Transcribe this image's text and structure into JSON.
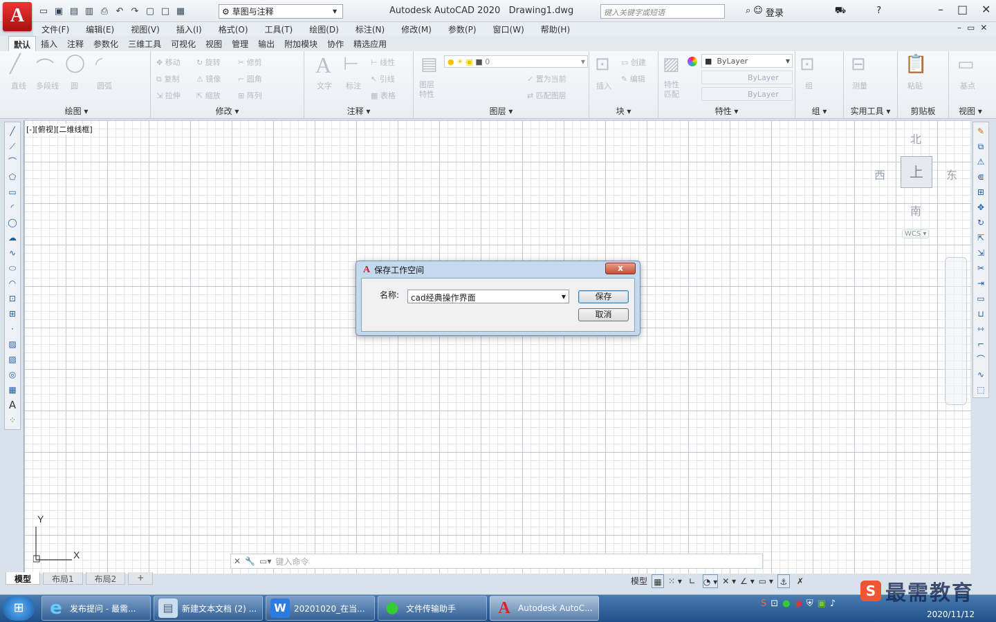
{
  "app": {
    "logo": "A",
    "title": "Autodesk AutoCAD 2020",
    "document": "Drawing1.dwg",
    "workspace": "草图与注释",
    "search_placeholder": "键入关键字或短语",
    "login": "登录",
    "accent": "#c8202a"
  },
  "menu": [
    "文件(F)",
    "编辑(E)",
    "视图(V)",
    "插入(I)",
    "格式(O)",
    "工具(T)",
    "绘图(D)",
    "标注(N)",
    "修改(M)",
    "参数(P)",
    "窗口(W)",
    "帮助(H)"
  ],
  "ribbon_tabs": [
    "默认",
    "插入",
    "注释",
    "参数化",
    "三维工具",
    "可视化",
    "视图",
    "管理",
    "输出",
    "附加模块",
    "协作",
    "精选应用"
  ],
  "ribbon": {
    "draw": {
      "title": "绘图",
      "items": [
        "直线",
        "多段线",
        "圆",
        "圆弧"
      ]
    },
    "modify": {
      "title": "修改",
      "items": [
        "移动",
        "旋转",
        "修剪",
        "复制",
        "镜像",
        "圆角",
        "拉伸",
        "缩放",
        "阵列"
      ]
    },
    "annotation": {
      "title": "注释",
      "items": [
        "文字",
        "标注",
        "线性",
        "引线",
        "表格"
      ]
    },
    "layers": {
      "title": "图层",
      "items": [
        "图层特性",
        "置为当前",
        "匹配图层"
      ],
      "current_layer": "0"
    },
    "block": {
      "title": "块",
      "items": [
        "插入",
        "创建",
        "编辑"
      ]
    },
    "properties": {
      "title": "特性",
      "items": [
        "特性匹配"
      ],
      "color": "ByLayer",
      "linetype": "ByLayer",
      "lineweight": "ByLayer"
    },
    "group": {
      "title": "组",
      "items": [
        "组"
      ]
    },
    "utilities": {
      "title": "实用工具",
      "items": [
        "测量"
      ]
    },
    "clipboard": {
      "title": "剪贴板",
      "items": [
        "粘贴"
      ]
    },
    "view": {
      "title": "视图",
      "items": [
        "基点"
      ]
    }
  },
  "viewport": {
    "label": "[-][俯视][二维线框]"
  },
  "viewcube": {
    "north": "北",
    "south": "南",
    "east": "东",
    "west": "西",
    "top": "上",
    "wcs": "WCS"
  },
  "ucs": {
    "x": "X",
    "y": "Y"
  },
  "command": {
    "placeholder": "键入命令"
  },
  "layout_tabs": [
    "模型",
    "布局1",
    "布局2",
    "+"
  ],
  "status": {
    "model": "模型"
  },
  "dialog": {
    "title": "保存工作空间",
    "label": "名称:",
    "value": "cad经典操作界面",
    "save": "保存",
    "cancel": "取消",
    "close": "x"
  },
  "taskbar": {
    "tasks": [
      "发布提问 - 最需...",
      "新建文本文档 (2) ...",
      "20201020_在当...",
      "文件传输助手",
      "Autodesk AutoC..."
    ],
    "date": "2020/11/12"
  },
  "watermark": "最需教育"
}
